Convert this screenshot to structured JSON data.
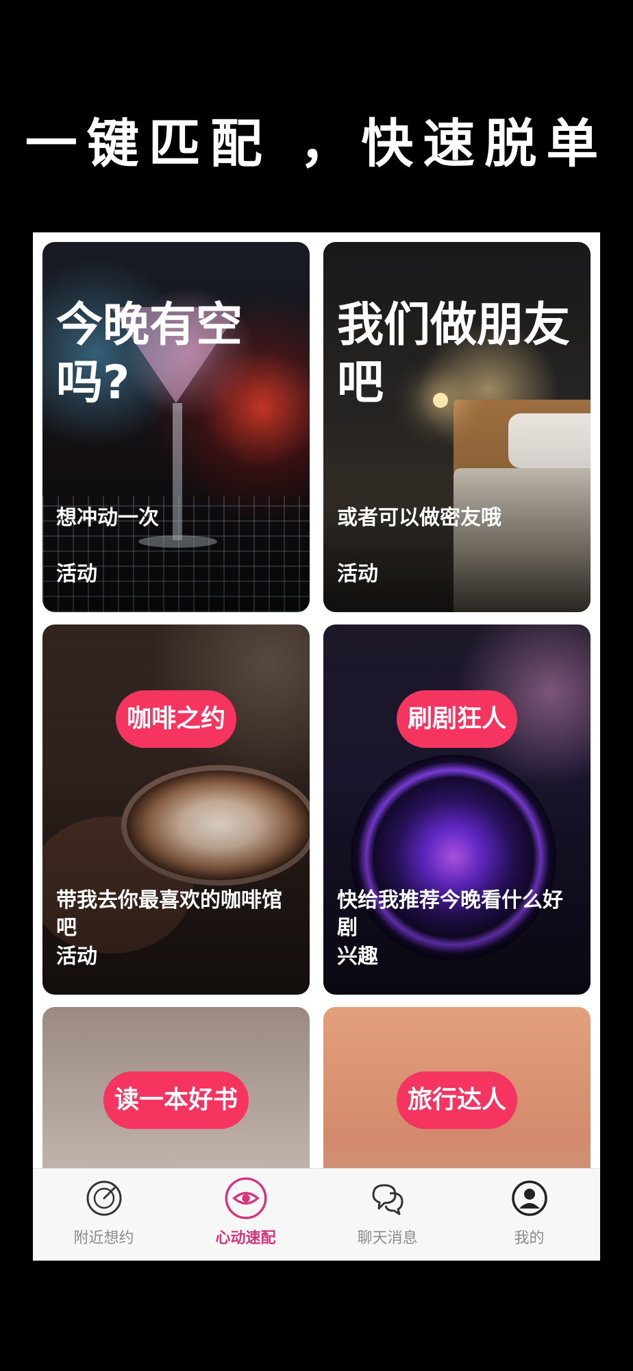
{
  "headline": "一键匹配 ，快速脱单",
  "cards": [
    {
      "title": "今晚有空吗?",
      "desc": "想冲动一次",
      "tag": "活动"
    },
    {
      "title": "我们做朋友吧",
      "desc": "或者可以做密友哦",
      "tag": "活动"
    },
    {
      "pill": "咖啡之约",
      "desc": "带我去你最喜欢的咖啡馆吧",
      "tag": "活动"
    },
    {
      "pill": "刷剧狂人",
      "desc": "快给我推荐今晚看什么好剧",
      "tag": "兴趣"
    },
    {
      "pill": "读一本好书"
    },
    {
      "pill": "旅行达人"
    }
  ],
  "tabbar": {
    "active_color": "#d4357d",
    "items": [
      {
        "label": "附近想约",
        "icon": "radar-icon"
      },
      {
        "label": "心动速配",
        "icon": "eye-icon"
      },
      {
        "label": "聊天消息",
        "icon": "chat-bubbles-icon"
      },
      {
        "label": "我的",
        "icon": "profile-icon"
      }
    ]
  },
  "colors": {
    "pill": "#f5345f",
    "background": "#000000"
  }
}
